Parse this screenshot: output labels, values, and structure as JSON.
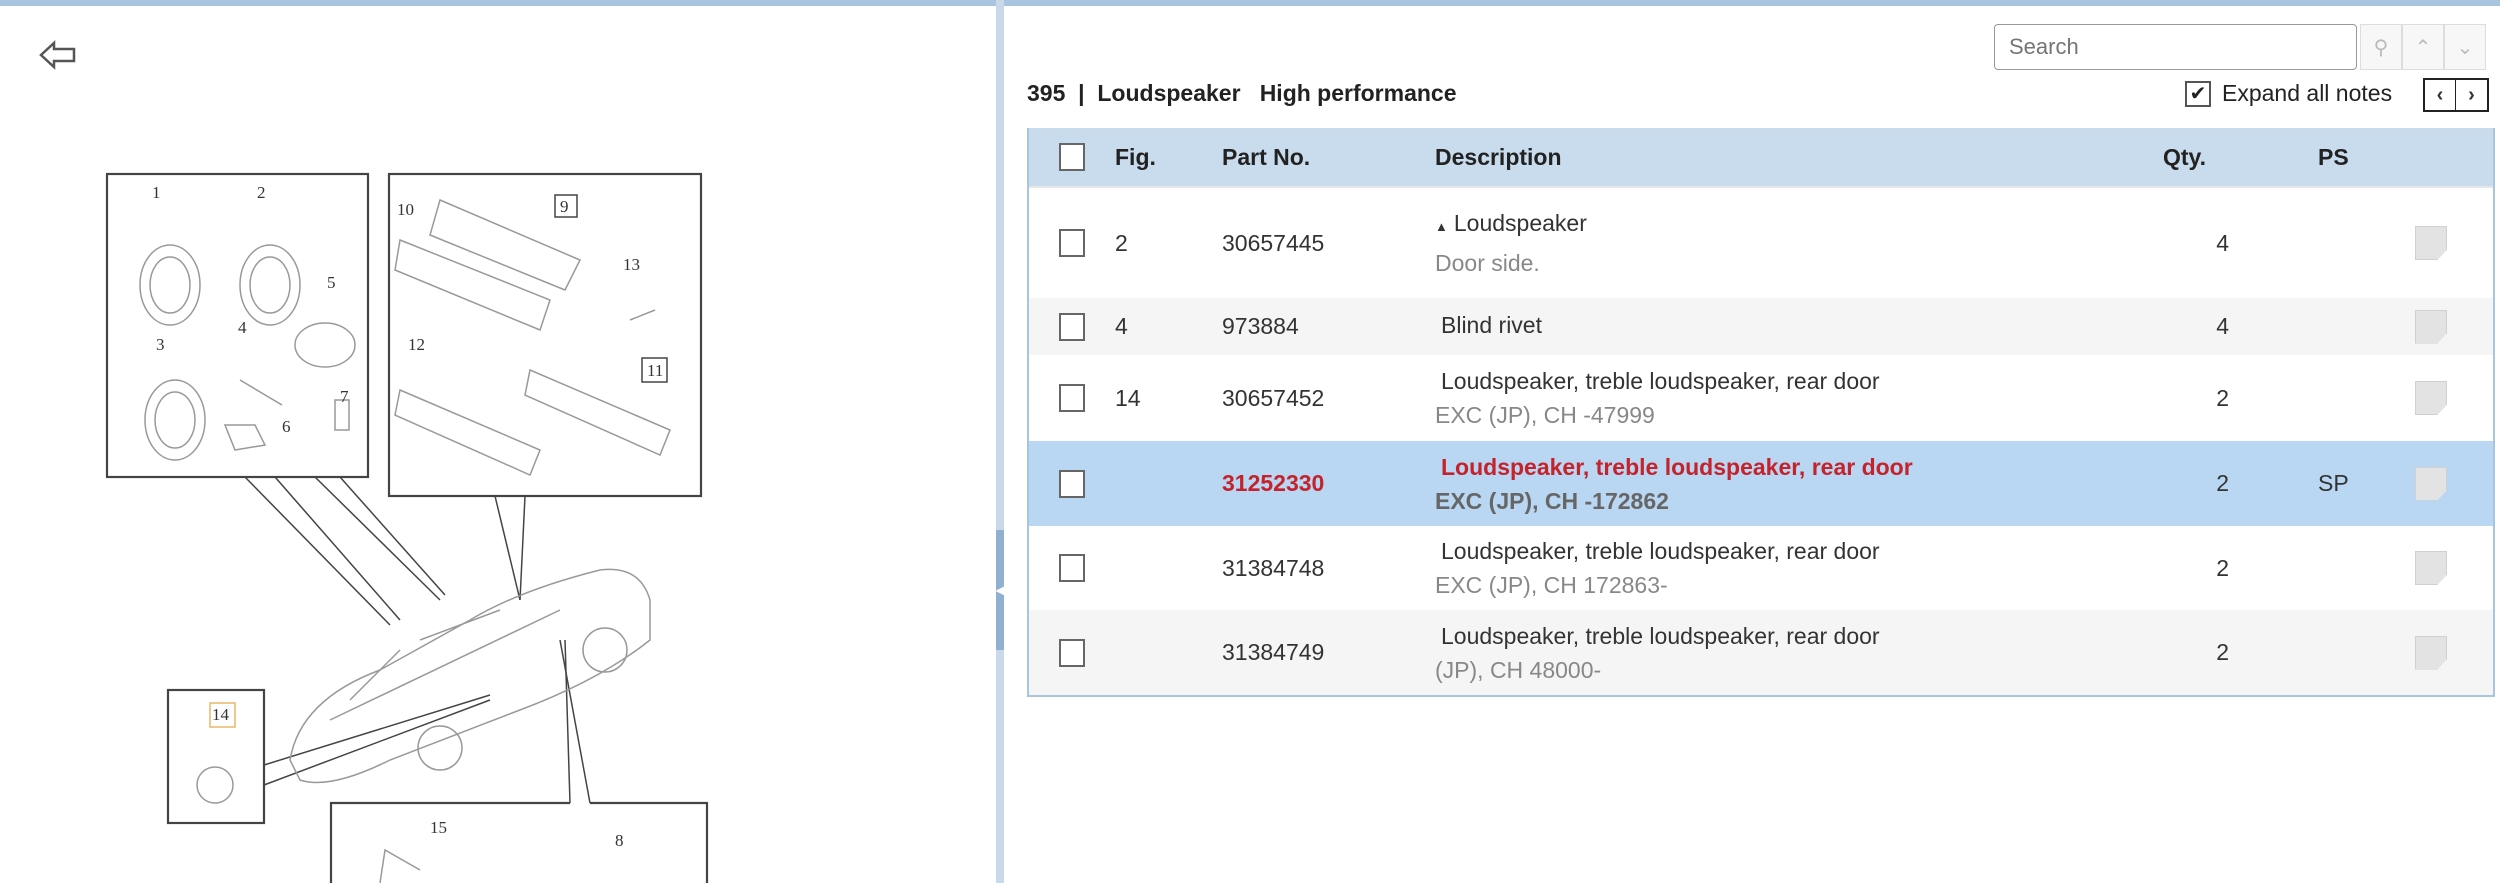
{
  "diagram": {
    "labels": [
      "1",
      "2",
      "3",
      "4",
      "5",
      "6",
      "7",
      "8",
      "9",
      "10",
      "11",
      "12",
      "13",
      "14",
      "15"
    ]
  },
  "search": {
    "placeholder": "Search"
  },
  "header": {
    "title": "395  |  Loudspeaker   High performance",
    "expand_label": "Expand all notes",
    "expand_checked": true
  },
  "table": {
    "columns": [
      "Fig.",
      "Part No.",
      "Description",
      "Qty.",
      "PS"
    ],
    "rows": [
      {
        "fig": "2",
        "part": "30657445",
        "desc": "Loudspeaker",
        "note": "Door side.",
        "qty": "4",
        "ps": "",
        "expander": "▲"
      },
      {
        "fig": "4",
        "part": "973884",
        "desc": "Blind rivet",
        "note": "",
        "qty": "4",
        "ps": ""
      },
      {
        "fig": "14",
        "part": "30657452",
        "desc": "Loudspeaker, treble loudspeaker, rear door",
        "note": "EXC (JP), CH -47999",
        "qty": "2",
        "ps": ""
      },
      {
        "fig": "",
        "part": "31252330",
        "desc": "Loudspeaker, treble loudspeaker, rear door",
        "note": "EXC (JP), CH -172862",
        "qty": "2",
        "ps": "SP"
      },
      {
        "fig": "",
        "part": "31384748",
        "desc": "Loudspeaker, treble loudspeaker, rear door",
        "note": "EXC (JP), CH 172863-",
        "qty": "2",
        "ps": ""
      },
      {
        "fig": "",
        "part": "31384749",
        "desc": "Loudspeaker, treble loudspeaker, rear door",
        "note": "(JP), CH 48000-",
        "qty": "2",
        "ps": ""
      }
    ]
  }
}
